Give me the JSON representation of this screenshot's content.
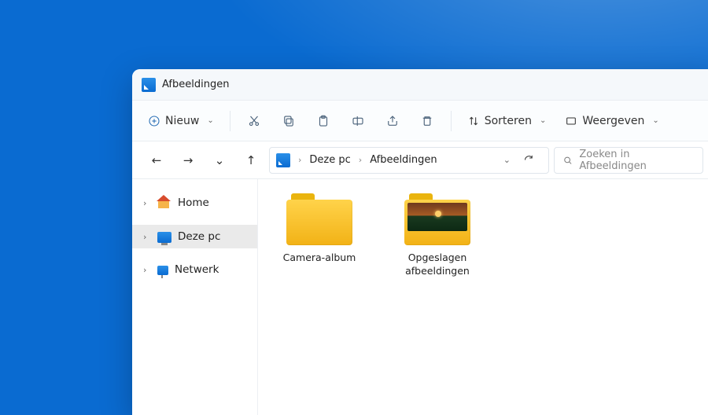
{
  "window": {
    "title": "Afbeeldingen"
  },
  "toolbar": {
    "new_label": "Nieuw",
    "sort_label": "Sorteren",
    "view_label": "Weergeven"
  },
  "breadcrumb": {
    "root": "Deze pc",
    "current": "Afbeeldingen"
  },
  "search": {
    "placeholder": "Zoeken in Afbeeldingen"
  },
  "sidebar": {
    "items": [
      {
        "label": "Home"
      },
      {
        "label": "Deze pc"
      },
      {
        "label": "Netwerk"
      }
    ]
  },
  "folders": [
    {
      "label": "Camera-album"
    },
    {
      "label": "Opgeslagen afbeeldingen"
    }
  ]
}
